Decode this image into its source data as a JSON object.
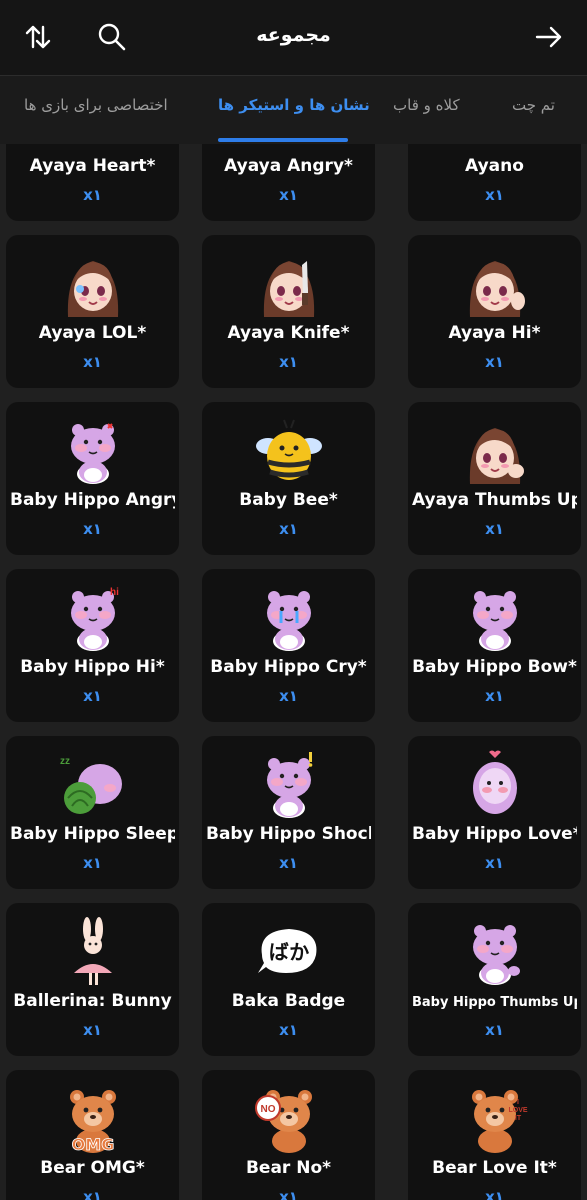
{
  "header": {
    "title": "مجموعه"
  },
  "tabs": [
    {
      "label": "تم چت",
      "active": false
    },
    {
      "label": "کلاه و قاب",
      "active": false
    },
    {
      "label": "نشان ها و استیکر ها",
      "active": true
    },
    {
      "label": "اختصاصی برای بازی ها",
      "active": false
    }
  ],
  "items": [
    {
      "name": "Ayaya Heart*",
      "count": "x۱",
      "icon": "ayaya-heart"
    },
    {
      "name": "Ayaya Angry*",
      "count": "x۱",
      "icon": "ayaya-angry"
    },
    {
      "name": "Ayano",
      "count": "x۱",
      "icon": "ayano"
    },
    {
      "name": "Ayaya LOL*",
      "count": "x۱",
      "icon": "ayaya-lol"
    },
    {
      "name": "Ayaya Knife*",
      "count": "x۱",
      "icon": "ayaya-knife"
    },
    {
      "name": "Ayaya Hi*",
      "count": "x۱",
      "icon": "ayaya-hi"
    },
    {
      "name": "Baby Hippo Angry*",
      "count": "x۱",
      "icon": "hippo-angry"
    },
    {
      "name": "Baby Bee*",
      "count": "x۱",
      "icon": "bee"
    },
    {
      "name": "Ayaya Thumbs Up*",
      "count": "x۱",
      "icon": "ayaya-thumbs-up"
    },
    {
      "name": "Baby Hippo Hi*",
      "count": "x۱",
      "icon": "hippo-hi",
      "badge": "hi"
    },
    {
      "name": "Baby Hippo Cry*",
      "count": "x۱",
      "icon": "hippo-cry"
    },
    {
      "name": "Baby Hippo Bow*",
      "count": "x۱",
      "icon": "hippo-bow"
    },
    {
      "name": "Baby Hippo Sleep*",
      "count": "x۱",
      "icon": "hippo-sleep",
      "badge": "zz"
    },
    {
      "name": "Baby Hippo Shocked*",
      "count": "x۱",
      "icon": "hippo-shocked",
      "badge": "!"
    },
    {
      "name": "Baby Hippo Love*",
      "count": "x۱",
      "icon": "hippo-love"
    },
    {
      "name": "Ballerina: Bunny",
      "count": "x۱",
      "icon": "bunny"
    },
    {
      "name": "Baka Badge",
      "count": "x۱",
      "icon": "baka",
      "badge": "ばか"
    },
    {
      "name": "Baby Hippo Thumbs Up*",
      "count": "x۱",
      "icon": "hippo-thumbs-up"
    },
    {
      "name": "Bear OMG*",
      "count": "x۱",
      "icon": "bear-omg",
      "badge": "OMG"
    },
    {
      "name": "Bear No*",
      "count": "x۱",
      "icon": "bear-no",
      "badge": "NO"
    },
    {
      "name": "Bear Love It*",
      "count": "x۱",
      "icon": "bear-love",
      "badge": "I LOVE IT"
    }
  ],
  "colors": {
    "accent": "#2e7de9",
    "card": "#111111",
    "background": "#202020"
  }
}
